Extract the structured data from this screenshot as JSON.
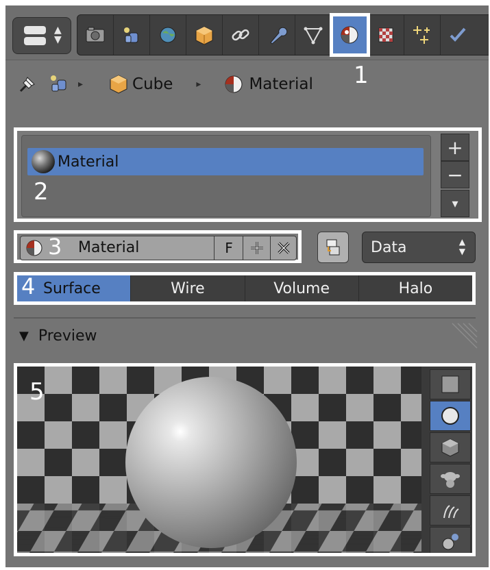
{
  "header": {
    "tabs": [
      {
        "icon": "render-camera-icon"
      },
      {
        "icon": "render-layers-icon"
      },
      {
        "icon": "scene-icon"
      },
      {
        "icon": "world-icon"
      },
      {
        "icon": "object-icon"
      },
      {
        "icon": "constraints-icon"
      },
      {
        "icon": "modifiers-wrench-icon"
      },
      {
        "icon": "mesh-data-icon"
      },
      {
        "icon": "material-icon",
        "active": true
      },
      {
        "icon": "texture-icon"
      },
      {
        "icon": "particles-icon"
      },
      {
        "icon": "physics-icon"
      }
    ],
    "callout": "1"
  },
  "breadcrumb": {
    "items": [
      "Cube",
      "Material"
    ]
  },
  "slots": {
    "callout": "2",
    "items": [
      "Material"
    ],
    "buttons": [
      "+",
      "−",
      "▾"
    ]
  },
  "datablock": {
    "callout": "3",
    "name": "Material",
    "fake_user": "F",
    "link_dropdown": "Data"
  },
  "type_tabs": {
    "callout": "4",
    "items": [
      "Surface",
      "Wire",
      "Volume",
      "Halo"
    ],
    "active": "Surface"
  },
  "preview": {
    "title": "Preview",
    "callout": "5",
    "shapes": [
      "plane-icon",
      "sphere-icon",
      "cube-icon",
      "monkey-icon",
      "hair-icon",
      "sphere-sky-icon"
    ],
    "active_shape": "sphere-icon"
  },
  "colors": {
    "panel": "#747474",
    "active": "#5680c2",
    "highlight": "#ffffff"
  }
}
